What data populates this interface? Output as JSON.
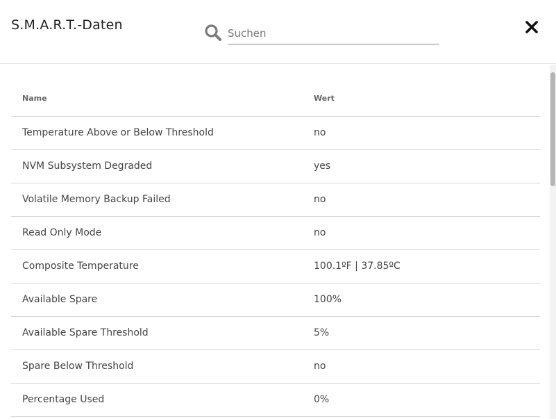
{
  "dialog": {
    "title": "S.M.A.R.T.-Daten",
    "close_icon": "close-icon"
  },
  "search": {
    "placeholder": "Suchen",
    "value": "",
    "icon": "search-icon"
  },
  "table": {
    "columns": [
      "Name",
      "Wert"
    ],
    "rows": [
      {
        "name": "Temperature Above or Below Threshold",
        "value": "no"
      },
      {
        "name": "NVM Subsystem Degraded",
        "value": "yes"
      },
      {
        "name": "Volatile Memory Backup Failed",
        "value": "no"
      },
      {
        "name": "Read Only Mode",
        "value": "no"
      },
      {
        "name": "Composite Temperature",
        "value": "100.1ºF | 37.85ºC"
      },
      {
        "name": "Available Spare",
        "value": "100%"
      },
      {
        "name": "Available Spare Threshold",
        "value": "5%"
      },
      {
        "name": "Spare Below Threshold",
        "value": "no"
      },
      {
        "name": "Percentage Used",
        "value": "0%"
      }
    ]
  },
  "colors": {
    "header_border": "#e3e3e3",
    "row_border": "#d6d6d6",
    "text": "#444444",
    "icon": "#7a7a7a"
  }
}
